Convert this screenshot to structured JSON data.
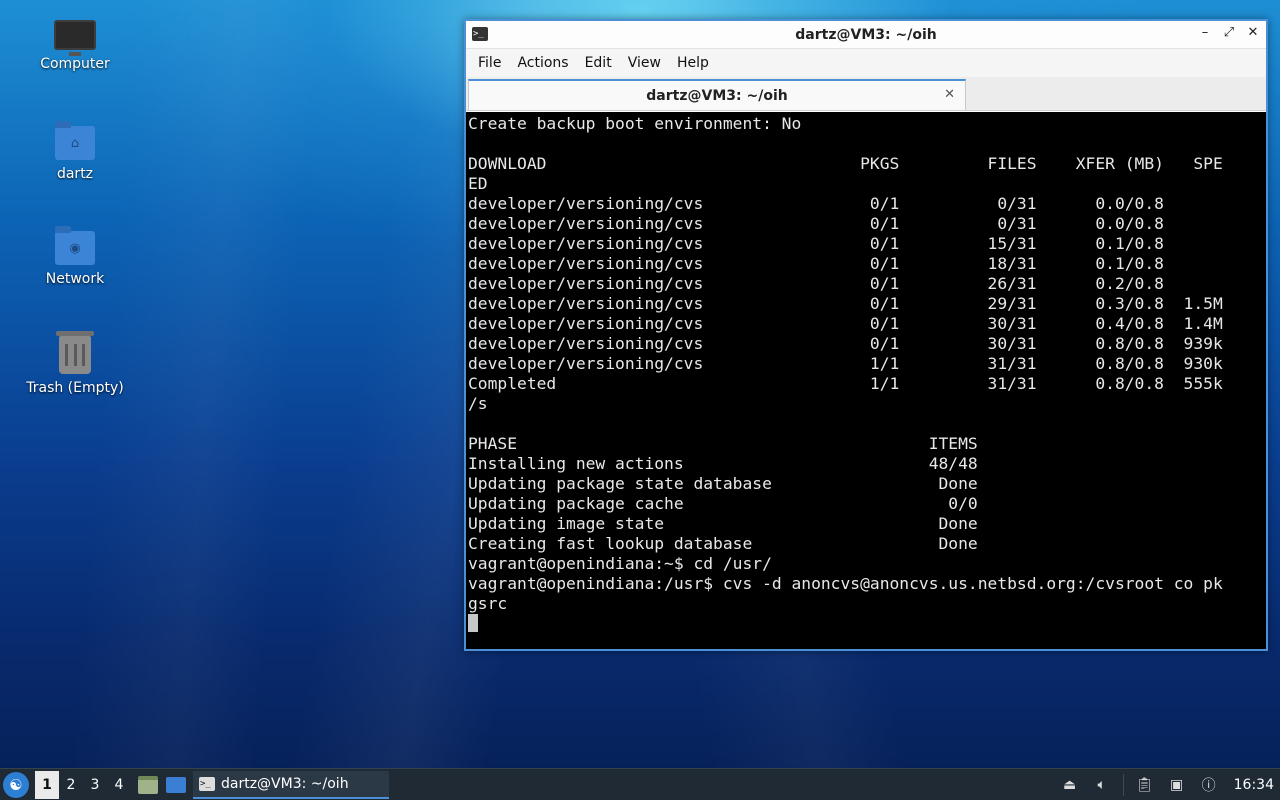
{
  "desktop": {
    "icons": [
      {
        "label": "Computer",
        "icon": "computer-icon"
      },
      {
        "label": "dartz",
        "icon": "home-folder-icon"
      },
      {
        "label": "Network",
        "icon": "network-folder-icon"
      },
      {
        "label": "Trash (Empty)",
        "icon": "trash-icon"
      }
    ]
  },
  "window": {
    "title": "dartz@VM3: ~/oih",
    "controls": {
      "minimize": "–",
      "maximize": "⤢",
      "close": "✕"
    },
    "menu": [
      "File",
      "Actions",
      "Edit",
      "View",
      "Help"
    ],
    "tab": {
      "label": "dartz@VM3: ~/oih",
      "close": "✕"
    },
    "terminal_lines": [
      "Create backup boot environment: No",
      "",
      "DOWNLOAD                                PKGS         FILES    XFER (MB)   SPE",
      "ED",
      "developer/versioning/cvs                 0/1          0/31      0.0/0.8",
      "developer/versioning/cvs                 0/1          0/31      0.0/0.8",
      "developer/versioning/cvs                 0/1         15/31      0.1/0.8",
      "developer/versioning/cvs                 0/1         18/31      0.1/0.8",
      "developer/versioning/cvs                 0/1         26/31      0.2/0.8",
      "developer/versioning/cvs                 0/1         29/31      0.3/0.8  1.5M",
      "developer/versioning/cvs                 0/1         30/31      0.4/0.8  1.4M",
      "developer/versioning/cvs                 0/1         30/31      0.8/0.8  939k",
      "developer/versioning/cvs                 1/1         31/31      0.8/0.8  930k",
      "Completed                                1/1         31/31      0.8/0.8  555k",
      "/s",
      "",
      "PHASE                                          ITEMS",
      "Installing new actions                         48/48",
      "Updating package state database                 Done",
      "Updating package cache                           0/0",
      "Updating image state                            Done",
      "Creating fast lookup database                   Done",
      "vagrant@openindiana:~$ cd /usr/",
      "vagrant@openindiana:/usr$ cvs -d anoncvs@anoncvs.us.netbsd.org:/cvsroot co pk",
      "gsrc"
    ]
  },
  "taskbar": {
    "workspaces": [
      "1",
      "2",
      "3",
      "4"
    ],
    "active_workspace": "1",
    "task_label": "dartz@VM3: ~/oih",
    "clock": "16:34"
  }
}
